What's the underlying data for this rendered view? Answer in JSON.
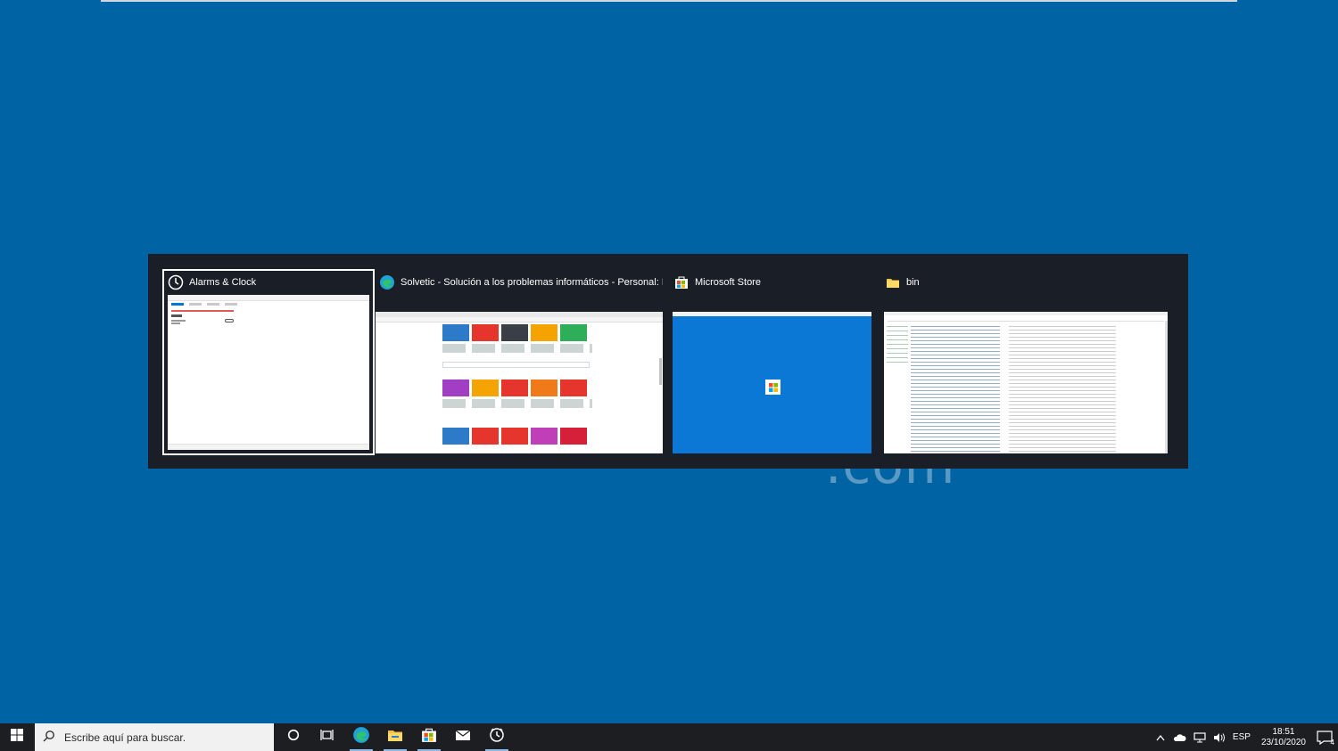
{
  "watermark": ".com",
  "switcher": {
    "windows": [
      {
        "title": "Alarms & Clock",
        "icon": "alarms-clock-icon",
        "selected": true
      },
      {
        "title": "Solvetic - Solución a los problemas informáticos - Personal: Micr...",
        "icon": "edge-icon",
        "selected": false
      },
      {
        "title": "Microsoft Store",
        "icon": "store-icon",
        "selected": false
      },
      {
        "title": "bin",
        "icon": "folder-icon",
        "selected": false
      }
    ]
  },
  "taskbar": {
    "search_placeholder": "Escribe aquí para buscar.",
    "language": "ESP",
    "time": "18:51",
    "date": "23/10/2020",
    "notification_count": "4",
    "icons": [
      "windows-start-icon",
      "search-icon",
      "cortana-icon",
      "task-view-icon",
      "edge-icon",
      "file-explorer-icon",
      "store-icon",
      "mail-icon",
      "alarms-clock-icon"
    ]
  },
  "colors": {
    "desktop": "#0063a3",
    "switcher_bg": "#1a1e26",
    "taskbar": "#1c1e22",
    "store_blue": "#0b78d6"
  }
}
